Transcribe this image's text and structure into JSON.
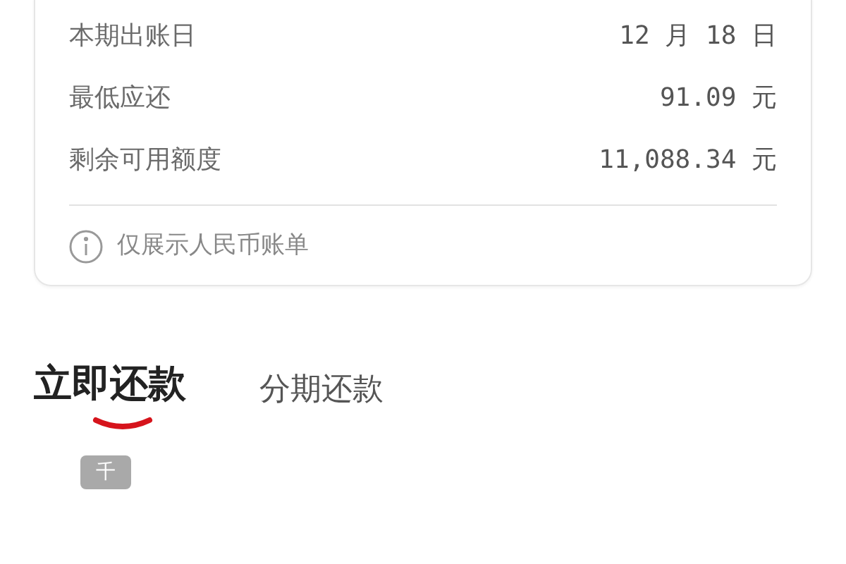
{
  "bill_summary": {
    "rows": [
      {
        "label": "本期出账日",
        "value": "12 月 18 日"
      },
      {
        "label": "最低应还",
        "value": "91.09 元"
      },
      {
        "label": "剩余可用额度",
        "value": "11,088.34 元"
      }
    ],
    "note": "仅展示人民币账单"
  },
  "tabs": [
    {
      "label": "立即还款",
      "selected": true
    },
    {
      "label": "分期还款",
      "selected": false
    }
  ],
  "amount": {
    "unit_badge": "千"
  }
}
